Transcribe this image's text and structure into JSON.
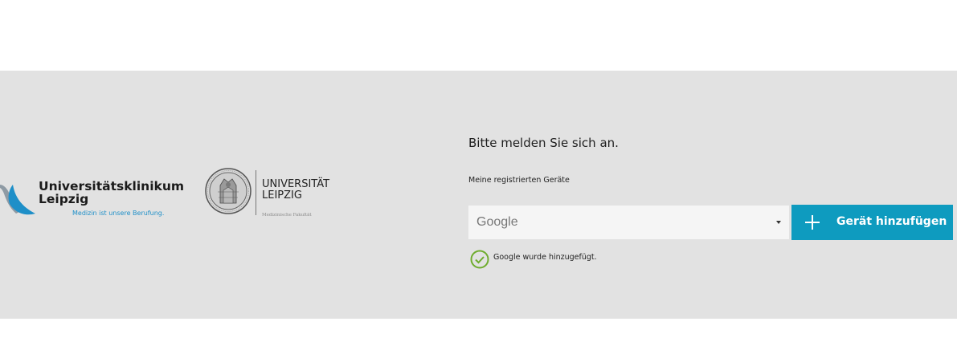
{
  "logos": {
    "ukl": {
      "name_line1": "Universitätsklinikum",
      "name_line2": "Leipzig",
      "slogan": "Medizin ist unsere Berufung.",
      "icon": "ukl-arc-logo-icon",
      "accent_color": "#1e8fc8"
    },
    "university": {
      "name_line1": "UNIVERSITÄT",
      "name_line2": "LEIPZIG",
      "faculty": "Medizinische Fakultät",
      "icon": "university-seal-icon"
    }
  },
  "login": {
    "title": "Bitte melden Sie sich an.",
    "devices_label": "Meine registrierten Geräte",
    "device_select": {
      "selected": "Google"
    },
    "add_device_button": {
      "label": "Gerät hinzufügen",
      "icon": "plus-icon",
      "color": "#0e9bbf"
    },
    "status": {
      "message": "Google wurde hinzugefügt.",
      "icon": "check-circle-icon",
      "color": "#6fac2e"
    }
  }
}
